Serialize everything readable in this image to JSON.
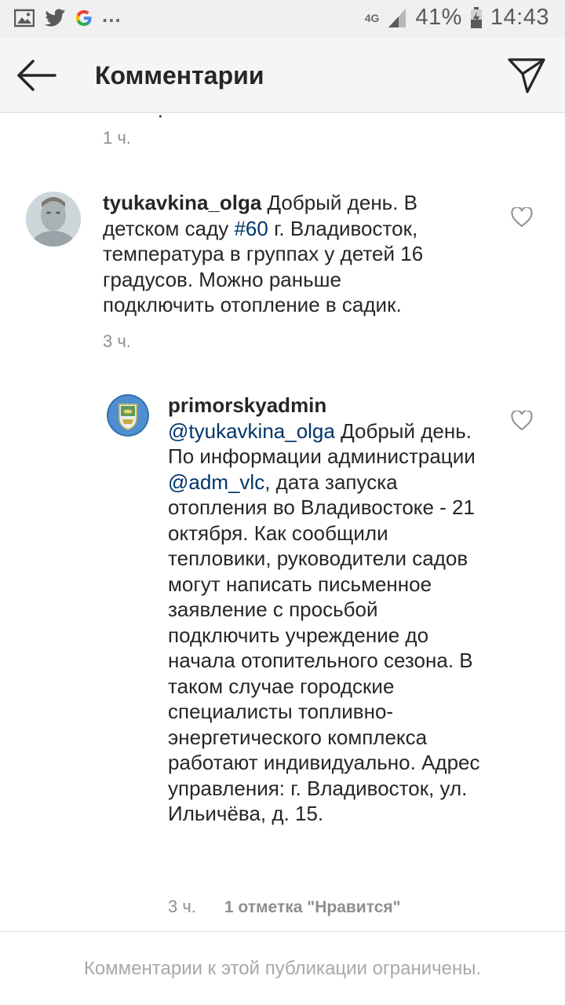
{
  "status_bar": {
    "left_icons": [
      "gallery-icon",
      "twitter-icon",
      "google-icon"
    ],
    "overflow": "...",
    "network": "4G",
    "battery": "41%",
    "time": "14:43"
  },
  "app_bar": {
    "title": "Комментарии"
  },
  "previous_comment": {
    "time": "1 ч."
  },
  "comments": [
    {
      "username": "tyukavkina_olga",
      "text_before_tag": " Добрый день. В детском саду ",
      "hashtag": "#60",
      "text_after_tag": " г. Владивосток, температура в группах у детей 16 градусов. Можно раньше подключить отопление в садик.",
      "time": "3 ч."
    },
    {
      "username": "primorskyadmin",
      "mention": "@tyukavkina_olga",
      "text_part1": " Добрый день. По информации администрации ",
      "mention2": "@adm_vlc",
      "text_part2": ", дата запуска отопления во Владивостоке - 21 октября. Как сообщили тепловики, руководители садов могут написать письменное заявление с просьбой подключить учреждение до начала отопительного сезона. В таком случае городские специалисты топливно-энергетического комплекса работают индивидуально. Адрес управления: г. Владивосток, ул. Ильичёва, д. 15.",
      "time": "3 ч.",
      "likes": "1 отметка \"Нравится\""
    }
  ],
  "footer": {
    "text": "Комментарии к этой публикации ограничены."
  }
}
